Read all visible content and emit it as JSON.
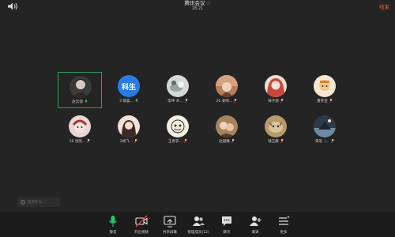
{
  "header": {
    "title": "腾讯会议",
    "time": "18:21",
    "end_label": "结束"
  },
  "participants": [
    {
      "name": "赵云瑞",
      "initials": "",
      "color": "#3a3a3a",
      "active": true
    },
    {
      "name": "3 蒋晨…",
      "initials": "科生",
      "color": "#2b7be6",
      "active": false
    },
    {
      "name": "李坤 木…",
      "initials": "",
      "color": "#d7d7d7",
      "active": false
    },
    {
      "name": "20 安晴…",
      "initials": "",
      "color": "#b77c5c",
      "active": false
    },
    {
      "name": "祥子源",
      "initials": "",
      "color": "#c9463c",
      "active": false
    },
    {
      "name": "曹开宣",
      "initials": "",
      "color": "#e7c694",
      "active": false
    },
    {
      "name": "16 张凯…",
      "initials": "",
      "color": "#e6d6d4",
      "active": false
    },
    {
      "name": "2胡飞…",
      "initials": "",
      "color": "#f1e2d6",
      "active": false
    },
    {
      "name": "王青衣…",
      "initials": "",
      "color": "#f3efe0",
      "active": false
    },
    {
      "name": "赵越曦",
      "initials": "",
      "color": "#a8845e",
      "active": false
    },
    {
      "name": "钱正康",
      "initials": "",
      "color": "#b79a6c",
      "active": false
    },
    {
      "name": "黄笔（…",
      "initials": "",
      "color": "#2d3a4a",
      "active": false
    }
  ],
  "chat": {
    "placeholder": "说点什么…"
  },
  "toolbar": [
    {
      "label": "静音",
      "icon": "mic-icon"
    },
    {
      "label": "开启视频",
      "icon": "video-off-icon"
    },
    {
      "label": "共享屏幕",
      "icon": "share-screen-icon"
    },
    {
      "label": "管理成员(12)",
      "icon": "members-icon"
    },
    {
      "label": "聊天",
      "icon": "chat-icon"
    },
    {
      "label": "邀请",
      "icon": "invite-icon"
    },
    {
      "label": "更多",
      "icon": "more-icon"
    }
  ],
  "colors": {
    "background": "#242424",
    "toolbar": "#1c1c1c",
    "active_border": "#2f9e5a",
    "end": "#ff5a4f",
    "mic": "#2fc46a",
    "video_off": "#e84a3f"
  }
}
